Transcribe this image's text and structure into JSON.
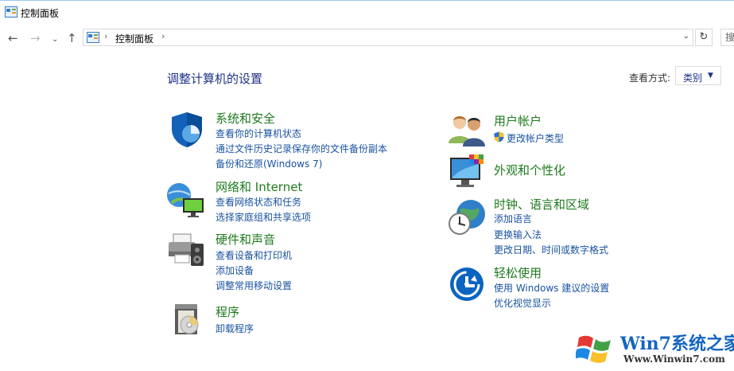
{
  "window": {
    "title": "控制面板"
  },
  "nav": {
    "back": "←",
    "forward": "→",
    "recent": "⌄",
    "up": "↑",
    "address": {
      "separator": "›",
      "crumb": "控制面板",
      "dropdown": "⌄"
    },
    "refresh": "↻",
    "search_placeholder": "搜"
  },
  "main": {
    "heading": "调整计算机的设置",
    "view_by_label": "查看方式:",
    "view_by_value": "类别",
    "view_by_caret": "▼"
  },
  "categories": {
    "system": {
      "title": "系统和安全",
      "links": [
        "查看你的计算机状态",
        "通过文件历史记录保存你的文件备份副本",
        "备份和还原(Windows 7)"
      ]
    },
    "network": {
      "title": "网络和 Internet",
      "links": [
        "查看网络状态和任务",
        "选择家庭组和共享选项"
      ]
    },
    "hardware": {
      "title": "硬件和声音",
      "links": [
        "查看设备和打印机",
        "添加设备",
        "调整常用移动设置"
      ]
    },
    "programs": {
      "title": "程序",
      "links": [
        "卸载程序"
      ]
    },
    "accounts": {
      "title": "用户帐户",
      "links": [
        "更改帐户类型"
      ]
    },
    "appearance": {
      "title": "外观和个性化",
      "links": []
    },
    "clock": {
      "title": "时钟、语言和区域",
      "links": [
        "添加语言",
        "更换输入法",
        "更改日期、时间或数字格式"
      ]
    },
    "ease": {
      "title": "轻松使用",
      "links": [
        "使用 Windows 建议的设置",
        "优化视觉显示"
      ]
    }
  },
  "watermark": {
    "brand": "Win7系统之家",
    "url": "Www.Winwin7.com"
  },
  "colors": {
    "heading": "#1e3287",
    "category_title": "#1e7a1e",
    "link": "#1a53a0",
    "accent_blue": "#0a64c0"
  }
}
